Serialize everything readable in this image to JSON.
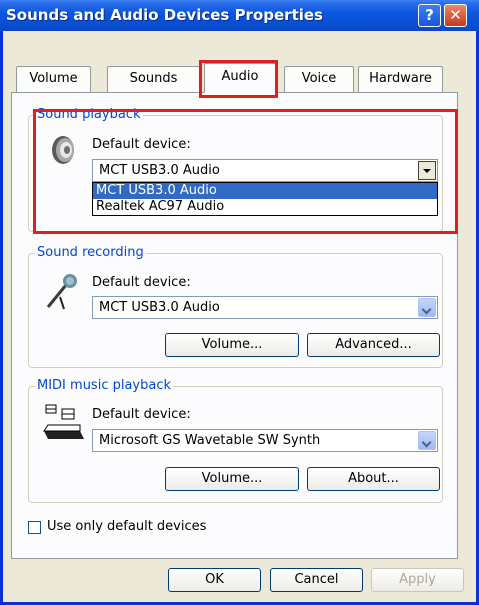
{
  "window": {
    "title": "Sounds and Audio Devices Properties",
    "help_glyph": "?",
    "close_glyph": "✕"
  },
  "tabs": [
    {
      "label": "Volume"
    },
    {
      "label": "Sounds"
    },
    {
      "label": "Audio",
      "active": true
    },
    {
      "label": "Voice"
    },
    {
      "label": "Hardware"
    }
  ],
  "playback": {
    "group_label": "Sound playback",
    "device_label": "Default device:",
    "selected": "MCT USB3.0 Audio",
    "options": [
      "MCT USB3.0 Audio",
      "Realtek AC97 Audio"
    ],
    "icon": "speaker-icon"
  },
  "recording": {
    "group_label": "Sound recording",
    "device_label": "Default device:",
    "selected": "MCT USB3.0 Audio",
    "volume_label": "Volume...",
    "advanced_label": "Advanced...",
    "icon": "microphone-icon"
  },
  "midi": {
    "group_label": "MIDI music playback",
    "device_label": "Default device:",
    "selected": "Microsoft GS Wavetable SW Synth",
    "volume_label": "Volume...",
    "about_label": "About...",
    "icon": "keyboard-icon"
  },
  "options": {
    "default_only_label": "Use only default devices",
    "default_only_checked": false
  },
  "footer": {
    "ok_label": "OK",
    "cancel_label": "Cancel",
    "apply_label": "Apply"
  },
  "colors": {
    "titlebar": "#0a58e0",
    "group_label": "#0046d5",
    "highlight": "#e02020",
    "selection": "#316ac5"
  }
}
